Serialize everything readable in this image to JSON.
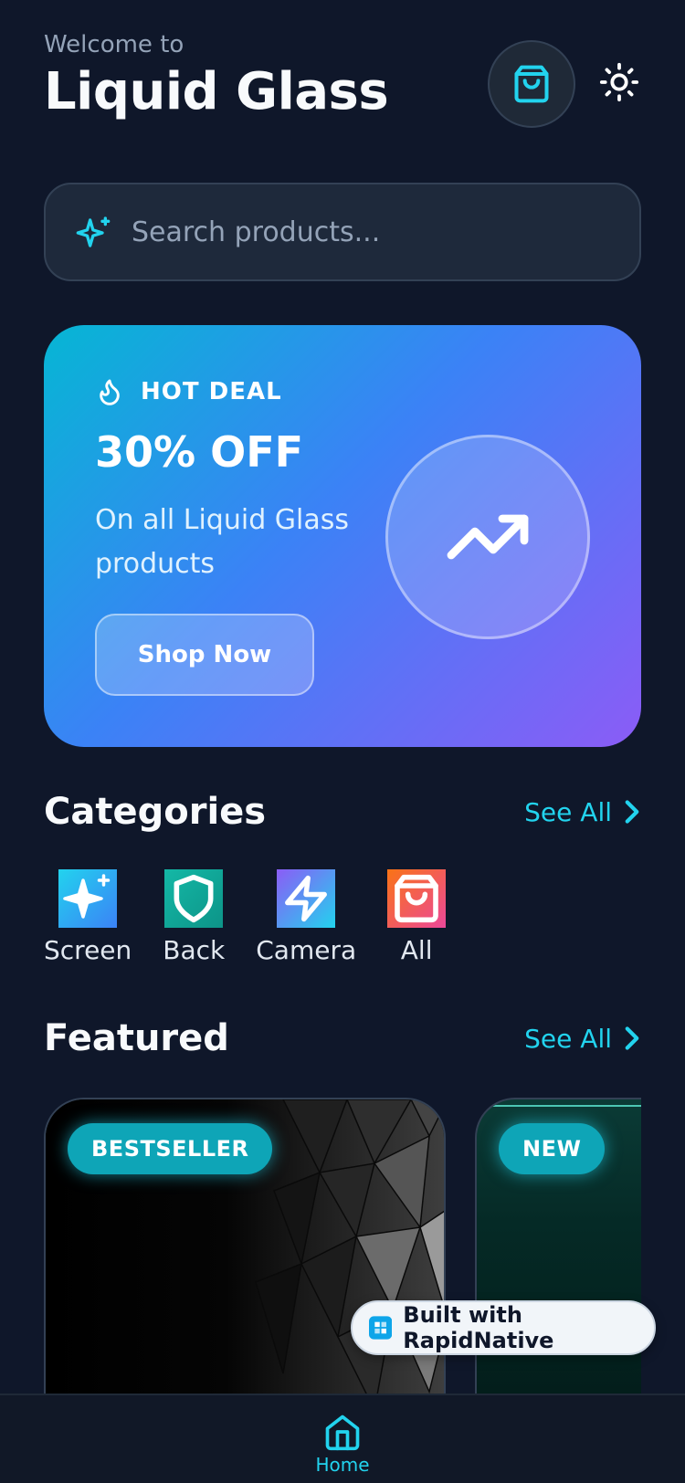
{
  "header": {
    "welcome": "Welcome to",
    "title": "Liquid Glass"
  },
  "search": {
    "placeholder": "Search products..."
  },
  "promo": {
    "tag": "HOT DEAL",
    "title": "30% OFF",
    "subtitle": "On all Liquid Glass products",
    "button": "Shop Now"
  },
  "categories": {
    "title": "Categories",
    "see_all": "See All",
    "items": [
      {
        "label": "Screen",
        "icon": "sparkles-icon"
      },
      {
        "label": "Back",
        "icon": "shield-icon"
      },
      {
        "label": "Camera",
        "icon": "zap-icon"
      },
      {
        "label": "All",
        "icon": "shopping-bag-icon"
      }
    ]
  },
  "featured": {
    "title": "Featured",
    "see_all": "See All",
    "cards": [
      {
        "badge": "BESTSELLER"
      },
      {
        "badge": "NEW"
      }
    ]
  },
  "built_with": "Built with RapidNative",
  "tabbar": {
    "home": "Home"
  },
  "colors": {
    "background": "#0f172a",
    "accent": "#22d3ee"
  }
}
